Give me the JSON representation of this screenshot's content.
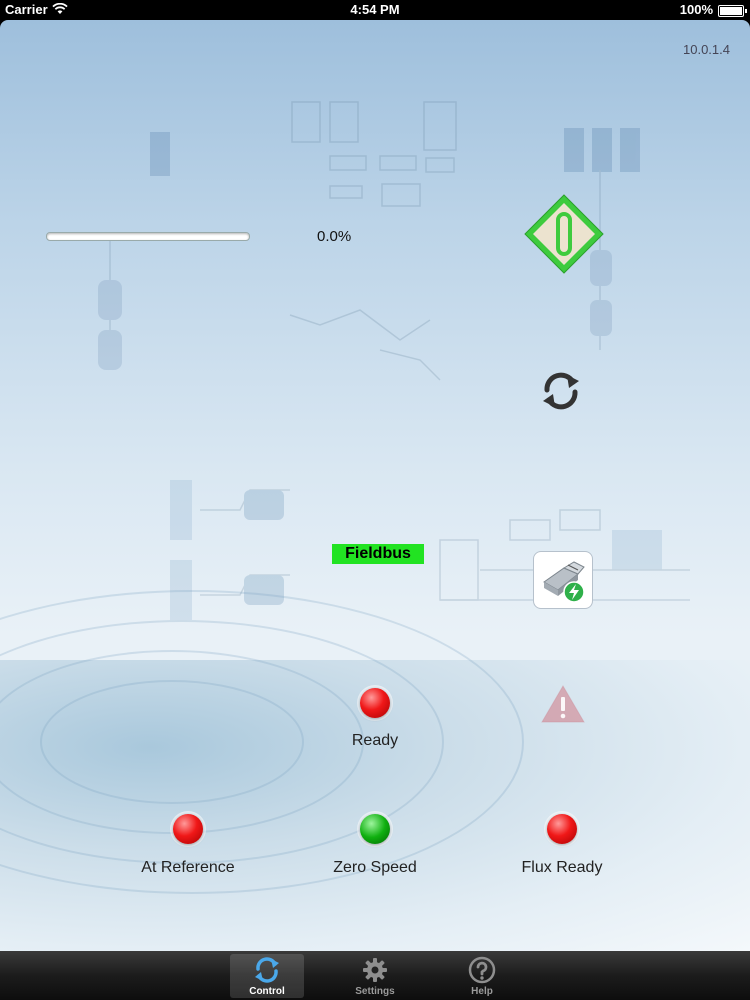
{
  "status_bar": {
    "carrier": "Carrier",
    "time": "4:54 PM",
    "battery": "100%"
  },
  "version": "10.0.1.4",
  "progress": {
    "value_label": "0.0%",
    "value": 0.0
  },
  "fieldbus": {
    "label": "Fieldbus",
    "color": "#22e322"
  },
  "indicators": {
    "ready": {
      "label": "Ready",
      "state": "red"
    },
    "at_reference": {
      "label": "At Reference",
      "state": "red"
    },
    "zero_speed": {
      "label": "Zero Speed",
      "state": "green"
    },
    "flux_ready": {
      "label": "Flux Ready",
      "state": "red"
    }
  },
  "tabs": [
    {
      "label": "Control",
      "icon": "refresh-icon",
      "active": true
    },
    {
      "label": "Settings",
      "icon": "gear-icon",
      "active": false
    },
    {
      "label": "Help",
      "icon": "help-icon",
      "active": false
    }
  ],
  "colors": {
    "stop_green": "#3ecb3e",
    "stop_fill": "#ece3cf",
    "led_red": "#f01818",
    "led_green": "#10b010",
    "warning_red": "#c04050"
  }
}
